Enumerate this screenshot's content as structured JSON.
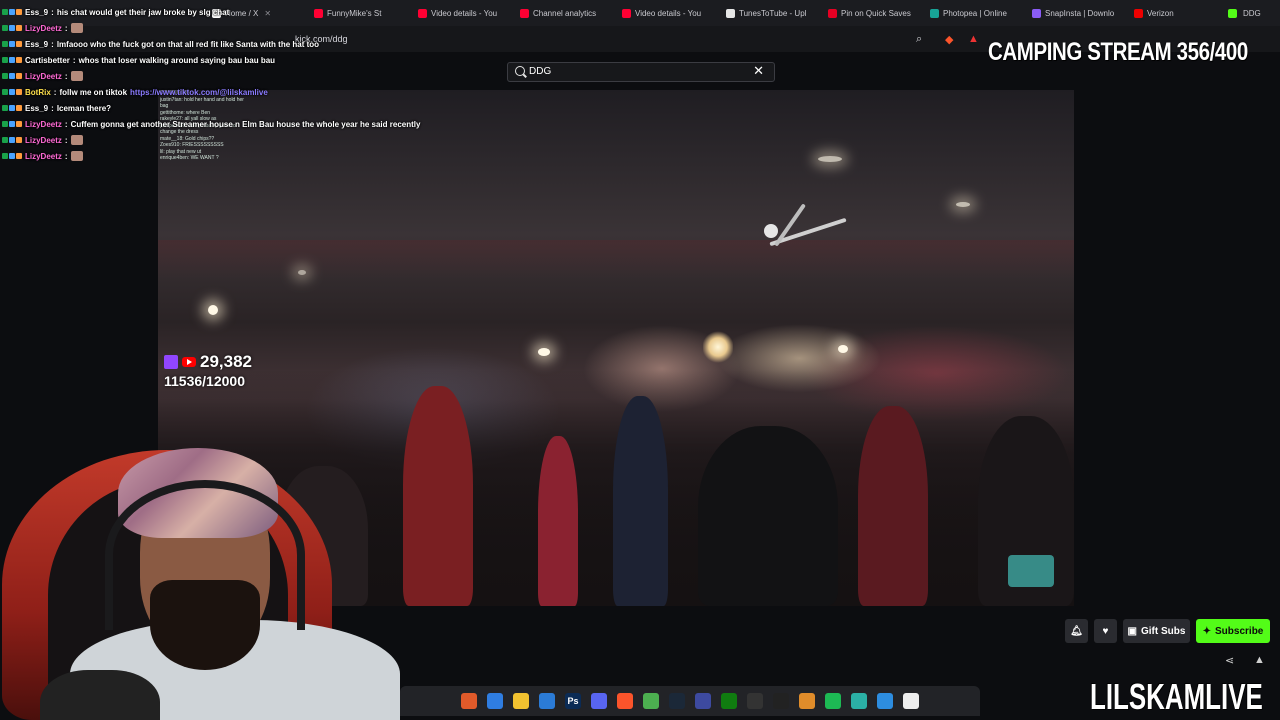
{
  "browser": {
    "tabs": [
      {
        "label": "Home / X",
        "color": "#ffffff"
      },
      {
        "label": "FunnyMike's St",
        "color": "#ff0033"
      },
      {
        "label": "Video details - You",
        "color": "#ff0033"
      },
      {
        "label": "Channel analytics",
        "color": "#ff0033"
      },
      {
        "label": "Video details - You",
        "color": "#ff0033"
      },
      {
        "label": "TunesToTube - Upl",
        "color": "#e6e6e6"
      },
      {
        "label": "Pin on Quick Saves",
        "color": "#e60023"
      },
      {
        "label": "Photopea | Online",
        "color": "#18a497"
      },
      {
        "label": "SnapInsta | Downlo",
        "color": "#8b5cf6"
      },
      {
        "label": "Verizon",
        "color": "#ee0000"
      }
    ],
    "active_tab_label": "DDG",
    "url": "kick.com/ddg"
  },
  "search": {
    "value": "DDG",
    "clear_icon": "close-icon"
  },
  "chat": [
    {
      "user": "Ess_9",
      "color": "#ffffff",
      "message": "his chat would get their jaw broke by slg chat",
      "emote": false
    },
    {
      "user": "LizyDeetz",
      "color": "#ff6ad5",
      "message": "",
      "emote": true
    },
    {
      "user": "Ess_9",
      "color": "#ffffff",
      "message": "lmfaooo who the fuck got on that all red fit like Santa with the hat too",
      "emote": false
    },
    {
      "user": "Cartisbetter",
      "color": "#ffffff",
      "message": "whos that loser walking around saying bau bau bau",
      "emote": false
    },
    {
      "user": "LizyDeetz",
      "color": "#ff6ad5",
      "message": "",
      "emote": true
    },
    {
      "user": "BotRix",
      "color": "#ffe14d",
      "message": "follw me on tiktok ",
      "link": "https://www.tiktok.com/@lilskamlive",
      "emote": false
    },
    {
      "user": "Ess_9",
      "color": "#ffffff",
      "message": "Iceman there?",
      "emote": false
    },
    {
      "user": "LizyDeetz",
      "color": "#ff6ad5",
      "message": "Cuffem gonna get another Streamer house n Elm Bau house the whole year he said recently",
      "emote": false
    },
    {
      "user": "LizyDeetz",
      "color": "#ff6ad5",
      "message": "",
      "emote": true
    },
    {
      "user": "LizyDeetz",
      "color": "#ff6ad5",
      "message": "",
      "emote": true
    }
  ],
  "video_chat": [
    "COMING666",
    "justin7tan: hold her hand and hold her",
    "bag",
    "gettithome: where Ben",
    "rakeyle27: all yall slow as",
    "javspace68: She probably gone to",
    "change the dress",
    "mate__18: Gold chips??",
    "Zoes910: FRIESSSSSSSSS",
    "lil: play that new ut",
    "enrique4ben: WE WANT ?"
  ],
  "overlay": {
    "viewer_count": "29,382",
    "sub_goal": "11536/12000",
    "stream_title": "CAMPING STREAM 356/400",
    "brand": "LILSKAMLIVE"
  },
  "actions": {
    "gift_subs": "Gift Subs",
    "subscribe": "Subscribe"
  },
  "taskbar_icons": [
    "paint-icon",
    "edge-icon",
    "folder-icon",
    "store-icon",
    "photoshop-icon",
    "discord-icon",
    "brave-icon",
    "chrome-icon",
    "steam-icon",
    "app-icon",
    "xbox-icon",
    "obs-icon",
    "capcut-icon",
    "shield-icon",
    "spotify-icon",
    "notes-icon",
    "photos-icon",
    "file-icon"
  ],
  "colors": {
    "kick_green": "#53fc18",
    "twitch": "#9146ff",
    "youtube": "#ff0000"
  }
}
